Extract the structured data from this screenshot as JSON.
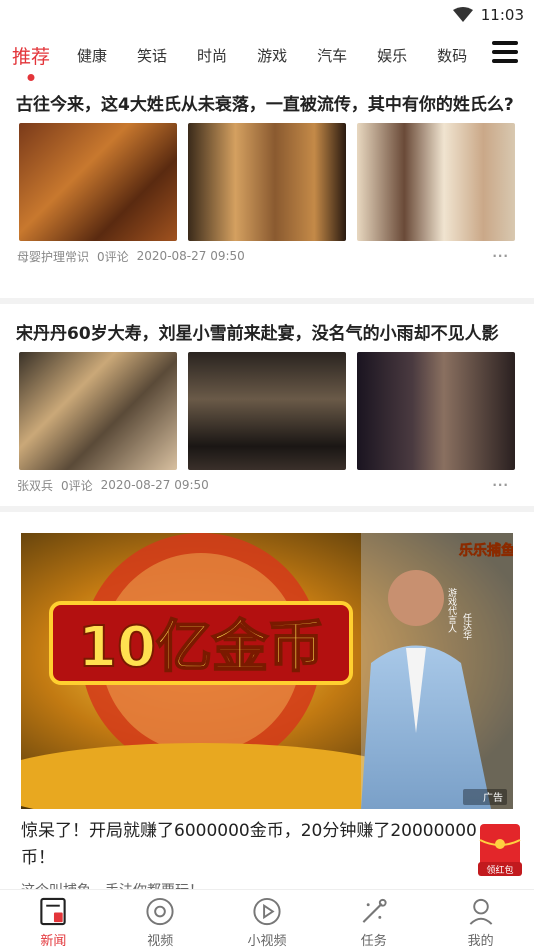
{
  "status": {
    "time": "11:03"
  },
  "tabs": [
    "推荐",
    "健康",
    "笑话",
    "时尚",
    "游戏",
    "汽车",
    "娱乐",
    "数码"
  ],
  "articles": [
    {
      "title": "古往今来，这4大姓氏从未衰落，一直被流传，其中有你的姓氏么?",
      "source": "母婴护理常识",
      "comments": "0评论",
      "time": "2020-08-27 09:50"
    },
    {
      "title": "宋丹丹60岁大寿，刘星小雪前来赴宴，没名气的小雨却不见人影",
      "source": "张双兵",
      "comments": "0评论",
      "time": "2020-08-27 09:50"
    }
  ],
  "ad": {
    "banner_text": "10亿金币",
    "game_logo": "乐乐捕鱼",
    "spokesperson_label": "游戏代言人",
    "spokesperson_name": "任达华",
    "title": "惊呆了！开局就赚了6000000金币，20分钟赚了20000000币！",
    "subtitle": "这个叫捕鱼，手法你都要玩！",
    "badge": "广告",
    "redpack_label": "领红包"
  },
  "navbar": [
    {
      "label": "新闻",
      "icon": "news-icon",
      "active": true
    },
    {
      "label": "视频",
      "icon": "video-icon",
      "active": false
    },
    {
      "label": "小视频",
      "icon": "short-video-icon",
      "active": false
    },
    {
      "label": "任务",
      "icon": "task-icon",
      "active": false
    },
    {
      "label": "我的",
      "icon": "profile-icon",
      "active": false
    }
  ],
  "colors": {
    "accent": "#e3353a",
    "separator": "#f2f2f2"
  }
}
